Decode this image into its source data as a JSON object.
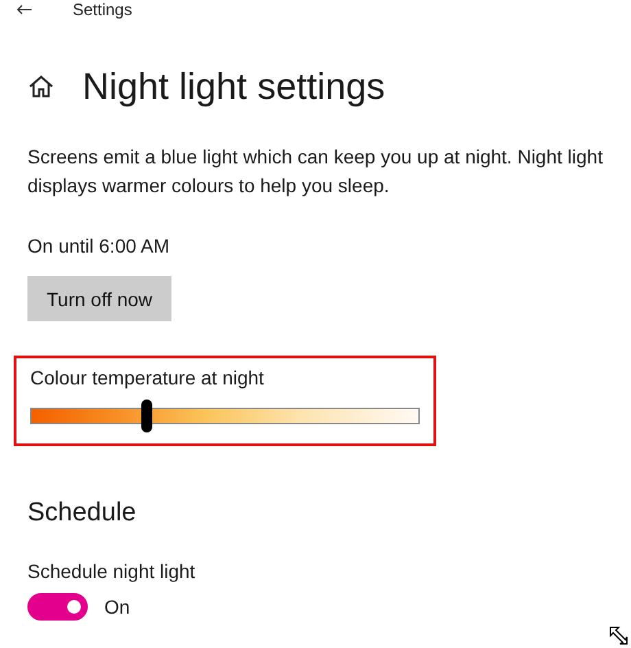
{
  "window": {
    "title": "Settings"
  },
  "page": {
    "title": "Night light settings"
  },
  "description": "Screens emit a blue light which can keep you up at night. Night light displays warmer colours to help you sleep.",
  "status": "On until 6:00 AM",
  "action_button": "Turn off now",
  "colour_temperature": {
    "label": "Colour temperature at night",
    "level": 0.3,
    "highlighted": true
  },
  "schedule": {
    "heading": "Schedule",
    "label": "Schedule night light",
    "on": true,
    "state_text": "On"
  }
}
